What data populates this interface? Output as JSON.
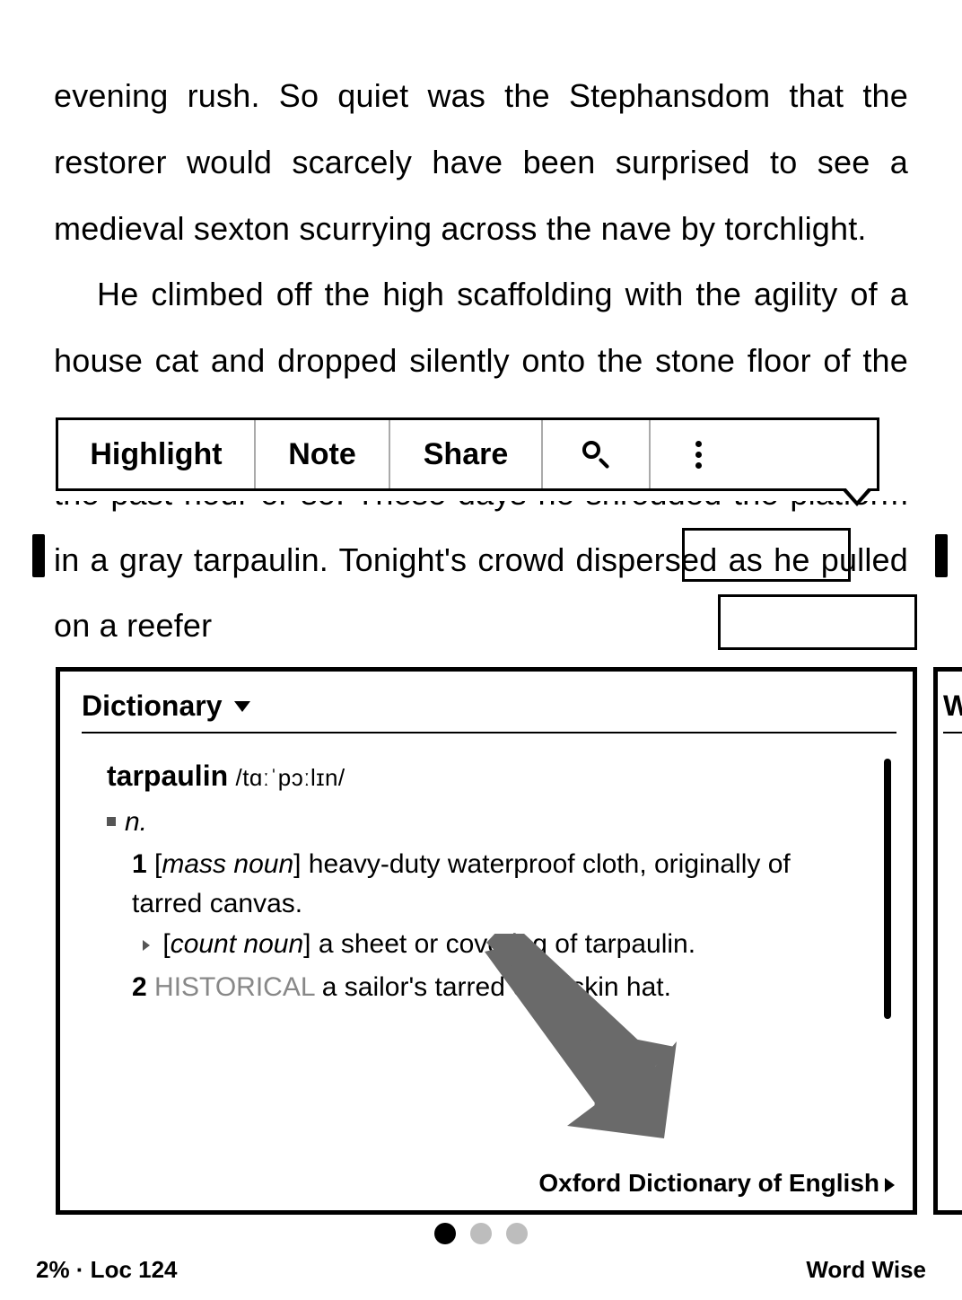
{
  "book": {
    "p1": "evening rush. So quiet was the Stephansdom that the restorer would scarcely have been surprised to see a medieval sexton scurrying across the nave by torchlight.",
    "p2_a": "He climbed off the high scaffolding with the agility of a house cat and dropped silently onto the stone floor of the chapel. A knot of tourists had been watching him work for the past hour or so. These days he shrouded the platform in a gray ",
    "p2_sel": "tarpaulin.",
    "p2_b": " Tonight's crowd dispersed as he pulled ",
    "p2_box2": "on a reefer"
  },
  "toolbar": {
    "highlight": "Highlight",
    "note": "Note",
    "share": "Share"
  },
  "dictionary": {
    "tab_label": "Dictionary",
    "headword": "tarpaulin",
    "pron": "/tɑːˈpɔːlɪn/",
    "pos": "n.",
    "s1_num": "1",
    "s1_label": "mass noun",
    "s1_def": "heavy-duty waterproof cloth, originally of tarred canvas.",
    "s1_sub_label": "count noun",
    "s1_sub_def": "a sheet or covering of tarpaulin.",
    "s2_num": "2",
    "s2_label": "HISTORICAL",
    "s2_def": "a sailor's tarred or oilskin hat.",
    "source": "Oxford Dictionary of English"
  },
  "peek": {
    "letter": "W"
  },
  "status": {
    "left": "2% · Loc 124",
    "right": "Word Wise"
  }
}
